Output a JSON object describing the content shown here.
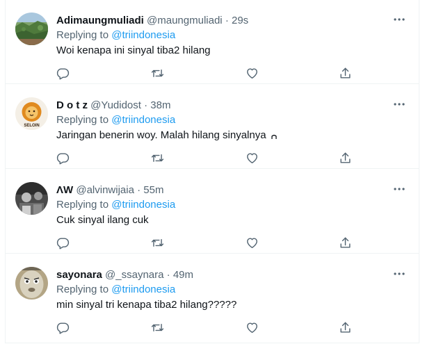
{
  "tweets": [
    {
      "name": "Adimaungmuliadi",
      "handle": "@maungmuliadi",
      "separator": "·",
      "time": "29s",
      "replying_prefix": "Replying to ",
      "replying_to": "@triindonesia",
      "text": "Woi kenapa ini sinyal tiba2 hilang",
      "avatar": "landscape-avatar"
    },
    {
      "name": "D o t z",
      "handle": "@Yudidost",
      "separator": "·",
      "time": "38m",
      "replying_prefix": "Replying to ",
      "replying_to": "@triindonesia",
      "text": "Jaringan benerin woy. Malah hilang sinyalnya",
      "avatar": "lion-logo-avatar",
      "avatar_label": "SELOIN"
    },
    {
      "name": "ΛW",
      "handle": "@alvinwijaia",
      "separator": "·",
      "time": "55m",
      "replying_prefix": "Replying to ",
      "replying_to": "@triindonesia",
      "text": "Cuk sinyal ilang cuk",
      "avatar": "dark-photo-avatar"
    },
    {
      "name": "sayonara",
      "handle": "@_ssaynara",
      "separator": "·",
      "time": "49m",
      "replying_prefix": "Replying to ",
      "replying_to": "@triindonesia",
      "text": "min sinyal tri kenapa tiba2 hilang?????",
      "avatar": "train-face-avatar"
    }
  ],
  "icons": {
    "more": "more-dots-icon",
    "reply": "reply-icon",
    "retweet": "retweet-icon",
    "like": "heart-icon",
    "share": "share-icon"
  },
  "colors": {
    "mention": "#1d9bf0",
    "secondary": "#536471",
    "primary": "#0f1419",
    "divider": "#eff3f4"
  }
}
